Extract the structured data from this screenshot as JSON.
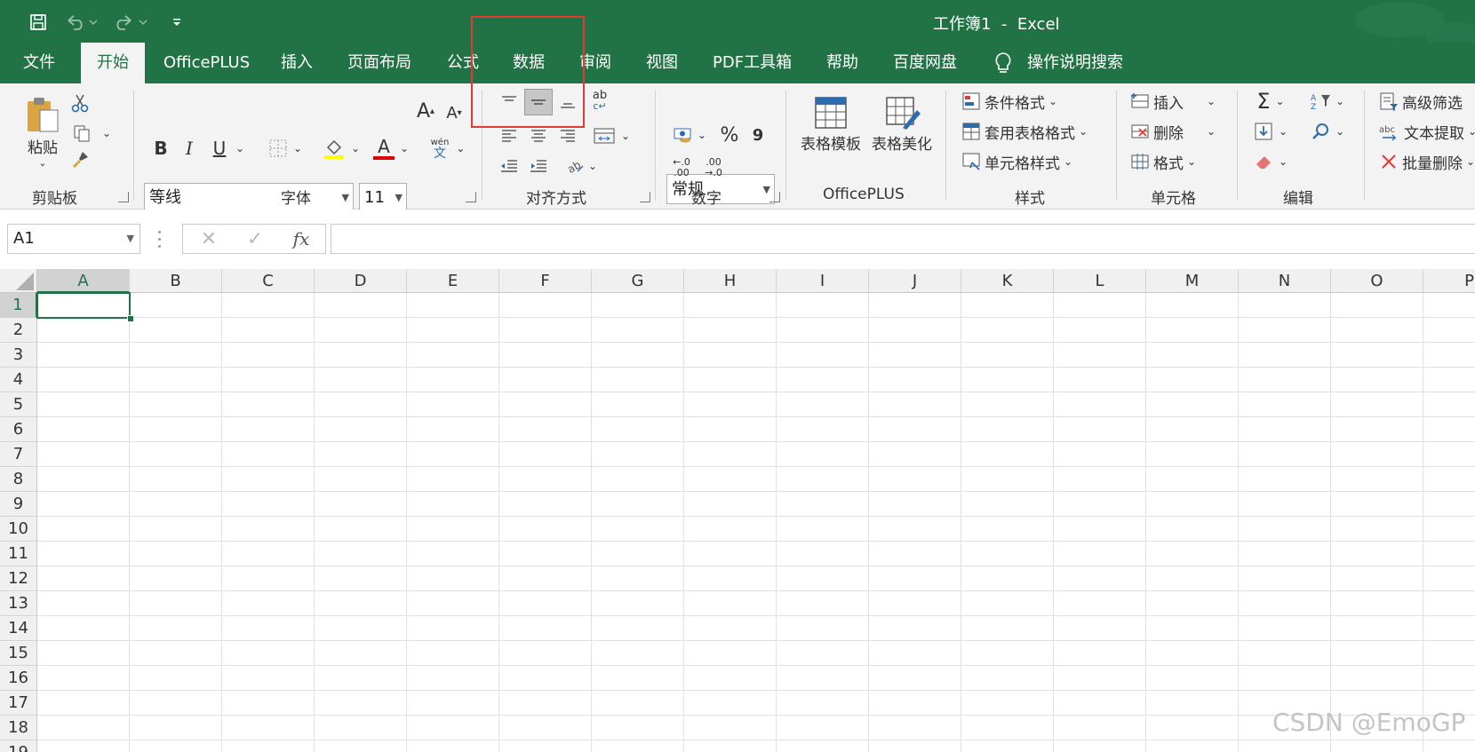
{
  "window": {
    "title": "工作簿1  -  Excel"
  },
  "tabs": [
    "文件",
    "开始",
    "OfficePLUS",
    "插入",
    "页面布局",
    "公式",
    "数据",
    "审阅",
    "视图",
    "PDF工具箱",
    "帮助",
    "百度网盘"
  ],
  "tell_me": "操作说明搜索",
  "ribbon": {
    "clipboard": {
      "paste": "粘贴",
      "group": "剪贴板"
    },
    "font": {
      "name": "等线",
      "size": "11",
      "bold": "B",
      "italic": "I",
      "underline": "U",
      "grow": "A",
      "shrink": "A",
      "font_color": "A",
      "phonetic_top": "wén",
      "phonetic_bottom": "文",
      "group": "字体"
    },
    "alignment": {
      "wrap_top": "ab",
      "wrap_bottom": "c↵",
      "group": "对齐方式"
    },
    "number": {
      "format": "常规",
      "percent": "%",
      "comma": "9",
      "inc_decimal": "←.0\n.00",
      "dec_decimal": ".00\n→.0",
      "group": "数字"
    },
    "officeplus": {
      "template": "表格模板",
      "beautify": "表格美化",
      "group": "OfficePLUS"
    },
    "styles": {
      "conditional": "条件格式",
      "table_format": "套用表格格式",
      "cell_styles": "单元格样式",
      "group": "样式"
    },
    "cells": {
      "insert": "插入",
      "delete": "删除",
      "format": "格式",
      "group": "单元格"
    },
    "editing": {
      "group": "编辑"
    },
    "extra": {
      "advanced_filter": "高级筛选",
      "text_extract": "文本提取",
      "batch_delete": "批量删除"
    }
  },
  "formula_bar": {
    "name_box": "A1",
    "fx": "fx",
    "cancel": "✕",
    "enter": "✓"
  },
  "sheet": {
    "columns": [
      "A",
      "B",
      "C",
      "D",
      "E",
      "F",
      "G",
      "H",
      "I",
      "J",
      "K",
      "L",
      "M",
      "N",
      "O",
      "P"
    ],
    "rows": [
      "1",
      "2",
      "3",
      "4",
      "5",
      "6",
      "7",
      "8",
      "9",
      "10",
      "11",
      "12",
      "13",
      "14",
      "15",
      "16",
      "17",
      "18",
      "19"
    ],
    "selected_cell": "A1"
  },
  "colors": {
    "brand": "#217346",
    "highlight_box": "#e53935",
    "fill_yellow": "#ffff00",
    "font_red": "#e00000"
  },
  "watermark": "CSDN @EmoGP"
}
